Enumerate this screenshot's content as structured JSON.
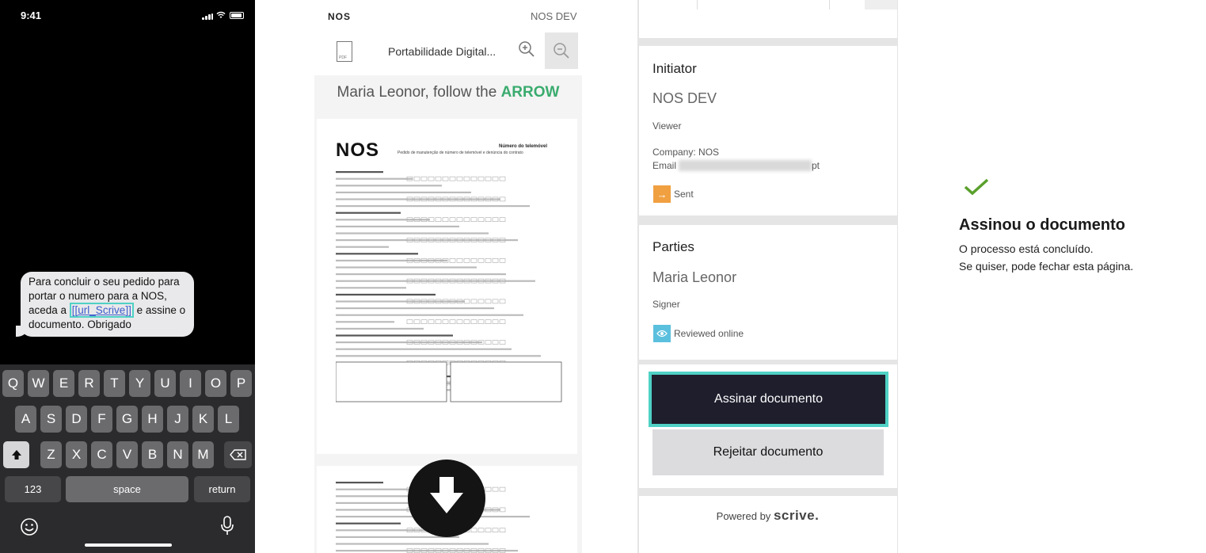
{
  "phone": {
    "time": "9:41",
    "message": {
      "text_before": "Para concluir o seu pedido para portar o numero para a NOS, aceda a ",
      "link": "[[url_Scrive]]",
      "text_after": " e assine o documento. Obrigado"
    },
    "keyboard": {
      "row1": [
        "Q",
        "W",
        "E",
        "R",
        "T",
        "Y",
        "U",
        "I",
        "O",
        "P"
      ],
      "row2": [
        "A",
        "S",
        "D",
        "F",
        "G",
        "H",
        "J",
        "K",
        "L"
      ],
      "row3": [
        "Z",
        "X",
        "C",
        "V",
        "B",
        "N",
        "M"
      ],
      "numbers_label": "123",
      "space_label": "space",
      "return_label": "return"
    }
  },
  "viewer": {
    "brand": "NOS",
    "env": "NOS DEV",
    "doc_name": "Portabilidade Digital...",
    "follow_prefix": "Maria Leonor, follow the ",
    "follow_strong": "ARROW",
    "form_title": "Número do telemóvel",
    "form_subtitle": "Pedido de manutenção de número de telemóvel e denúncia do contrato"
  },
  "sign_panel": {
    "initiator": {
      "heading": "Initiator",
      "name": "NOS DEV",
      "role": "Viewer",
      "company": "Company: NOS",
      "email_label": "Email",
      "email_suffix": "pt",
      "status": "Sent"
    },
    "parties": {
      "heading": "Parties",
      "name": "Maria Leonor",
      "role": "Signer",
      "status": "Reviewed online"
    },
    "sign_button": "Assinar documento",
    "reject_button": "Rejeitar documento",
    "powered_by": "Powered by",
    "powered_brand": "scrive."
  },
  "completion": {
    "title": "Assinou o documento",
    "line1": "O processo está concluído.",
    "line2": "Se quiser, pode fechar esta página."
  },
  "colors": {
    "accent_teal": "#4fd1c5",
    "arrow_green": "#3aab6e",
    "sent_orange": "#f0a040",
    "reviewed_blue": "#5bc0de",
    "check_green": "#5aa02c",
    "sign_button": "#1e1e2d"
  }
}
